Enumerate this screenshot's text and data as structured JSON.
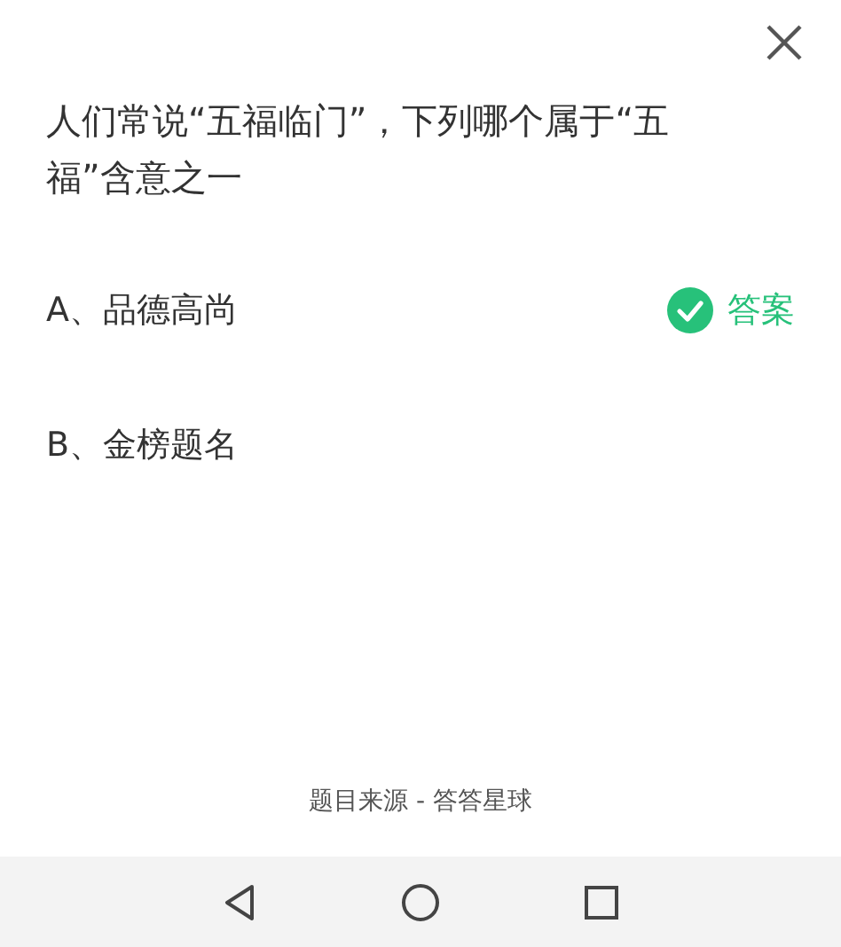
{
  "question": "人们常说“五福临门”，下列哪个属于“五福”含意之一",
  "answer_label": "答案",
  "options": [
    {
      "label": "A、品德高尚",
      "correct": true
    },
    {
      "label": "B、金榜题名",
      "correct": false
    }
  ],
  "source": "题目来源 - 答答星球"
}
